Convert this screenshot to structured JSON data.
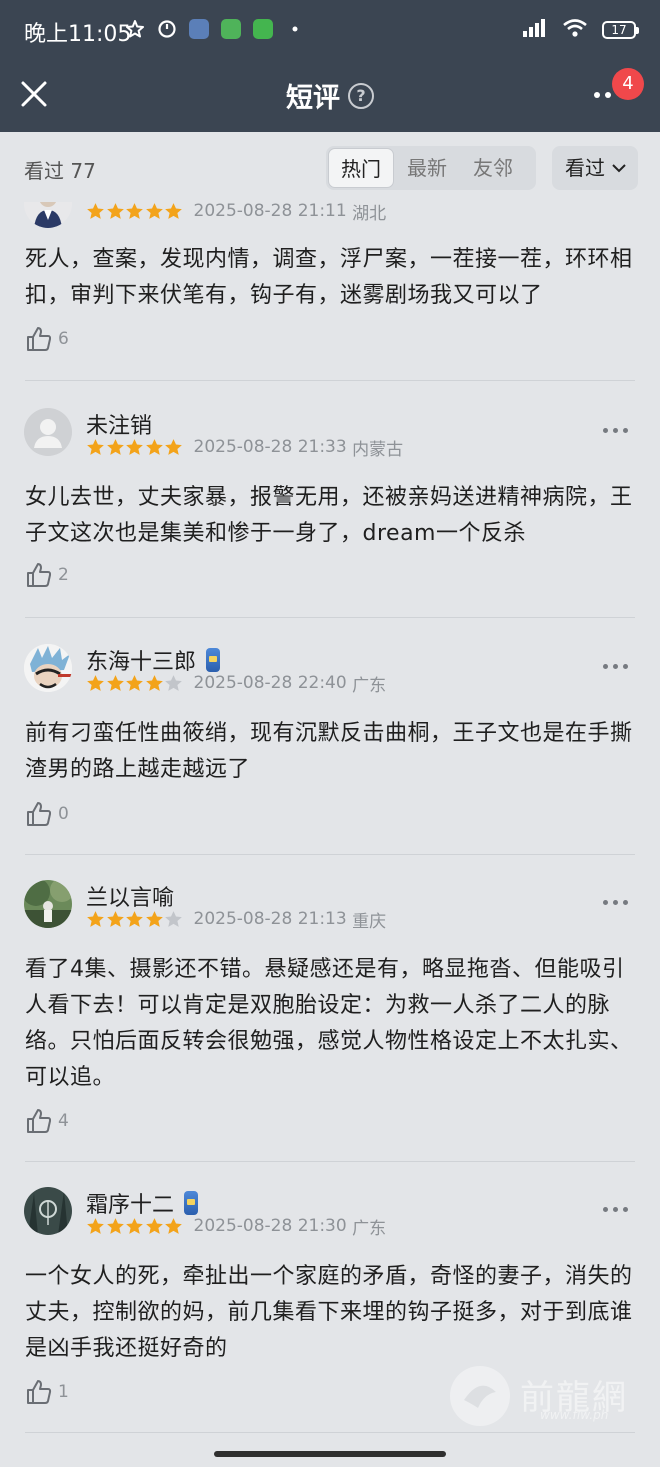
{
  "status_bar": {
    "time": "晚上11:05",
    "battery": "17"
  },
  "header": {
    "title": "短评",
    "help_glyph": "?",
    "notification_count": "4"
  },
  "subheader": {
    "watched_label": "看过",
    "watched_count": "77",
    "tabs": [
      "热门",
      "最新",
      "友邻"
    ],
    "active_tab": "热门",
    "filter_label": "看过"
  },
  "reviews": [
    {
      "username": "",
      "rating": 5,
      "date": "2025-08-28 21:11",
      "location": "湖北",
      "content": "死人，查案，发现内情，调查，浮尸案，一茬接一茬，环环相扣，审判下来伏笔有，钩子有，迷雾剧场我又可以了",
      "likes": "6"
    },
    {
      "username": "未注销",
      "rating": 5,
      "date": "2025-08-28 21:33",
      "location": "内蒙古",
      "content": "女儿去世，丈夫家暴，报警无用，还被亲妈送进精神病院，王子文这次也是集美和惨于一身了，dream一个反杀",
      "likes": "2"
    },
    {
      "username": "东海十三郎",
      "rating": 4,
      "date": "2025-08-28 22:40",
      "location": "广东",
      "content": "前有刁蛮任性曲筱绡，现有沉默反击曲桐，王子文也是在手撕渣男的路上越走越远了",
      "likes": "0"
    },
    {
      "username": "兰以言喻",
      "rating": 4,
      "date": "2025-08-28 21:13",
      "location": "重庆",
      "content": "看了4集、摄影还不错。悬疑感还是有，略显拖沓、但能吸引人看下去！可以肯定是双胞胎设定：为救一人杀了二人的脉络。只怕后面反转会很勉强，感觉人物性格设定上不太扎实、可以追。",
      "likes": "4"
    },
    {
      "username": "霜序十二",
      "rating": 5,
      "date": "2025-08-28 21:30",
      "location": "广东",
      "content": "一个女人的死，牵扯出一个家庭的矛盾，奇怪的妻子，消失的丈夫，控制欲的妈，前几集看下来埋的钩子挺多，对于到底谁是凶手我还挺好奇的",
      "likes": "1"
    }
  ],
  "watermark": {
    "text": "前龍網",
    "url": "www.flw.ph"
  },
  "colors": {
    "header_bg": "#3b4552",
    "page_bg": "#e3e5e8",
    "star_on": "#f3a31a",
    "star_off": "#c2c5ca",
    "badge": "#f0484b"
  }
}
